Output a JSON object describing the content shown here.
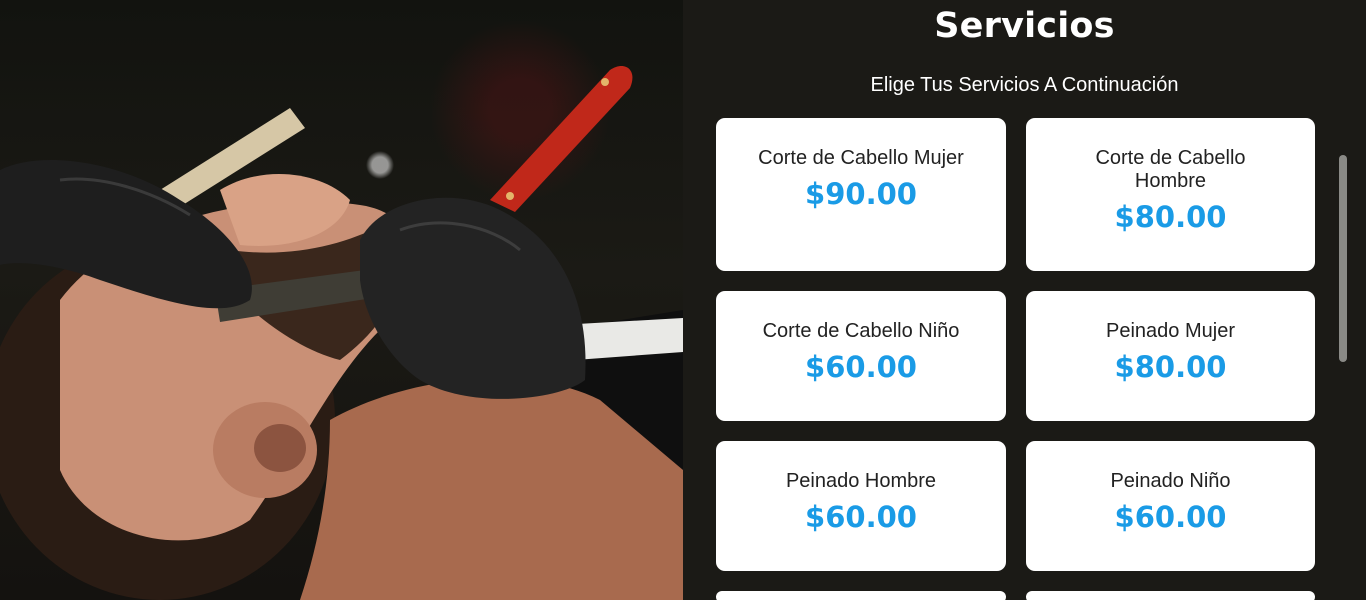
{
  "colors": {
    "background": "#1b1a16",
    "card": "#ffffff",
    "price": "#1a9be6",
    "text": "#ffffff"
  },
  "hero": {
    "icon": "barber-shave-photo"
  },
  "services": {
    "title": "Servicios",
    "subtitle": "Elige Tus Servicios A Continuación",
    "items": [
      {
        "name": "Corte de Cabello Mujer",
        "price": "$90.00"
      },
      {
        "name": "Corte de Cabello Hombre",
        "price": "$80.00"
      },
      {
        "name": "Corte de Cabello Niño",
        "price": "$60.00"
      },
      {
        "name": "Peinado Mujer",
        "price": "$80.00"
      },
      {
        "name": "Peinado Hombre",
        "price": "$60.00"
      },
      {
        "name": "Peinado Niño",
        "price": "$60.00"
      },
      {
        "name": "",
        "price": ""
      },
      {
        "name": "",
        "price": ""
      }
    ]
  }
}
